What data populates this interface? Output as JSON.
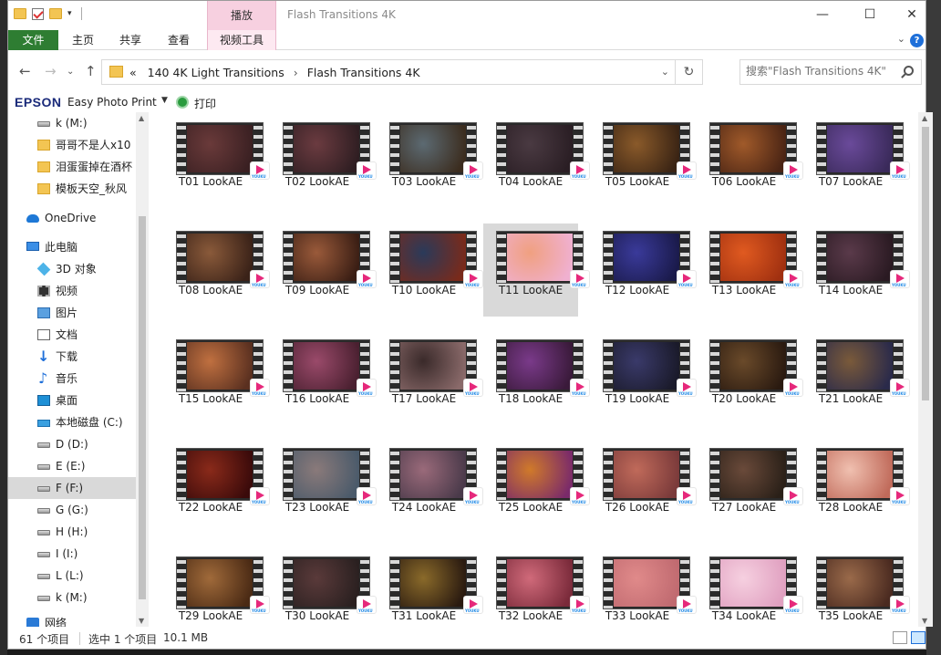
{
  "window_title": "Flash Transitions 4K",
  "context_tab_header": "播放",
  "ribbon_tabs": [
    {
      "label": "文件"
    },
    {
      "label": "主页"
    },
    {
      "label": "共享"
    },
    {
      "label": "查看"
    },
    {
      "label": "视频工具"
    }
  ],
  "address": {
    "overflow": "«",
    "segments": [
      "140 4K Light Transitions",
      "Flash Transitions 4K"
    ]
  },
  "search": {
    "placeholder": "搜索\"Flash Transitions 4K\""
  },
  "epson": {
    "logo": "EPSON",
    "app": "Easy Photo Print",
    "print_label": "打印"
  },
  "sidebar": [
    {
      "label": "k (M:)",
      "icon": "drive-icon"
    },
    {
      "label": "哥哥不是人x10",
      "icon": "folder-icon"
    },
    {
      "label": "泪蛋蛋掉在酒杯",
      "icon": "folder-icon"
    },
    {
      "label": "模板天空_秋风",
      "icon": "folder-icon"
    },
    {
      "label": "OneDrive",
      "icon": "cloud-icon"
    },
    {
      "label": "此电脑",
      "icon": "pc-icon"
    },
    {
      "label": "3D 对象",
      "icon": "3d-objects-icon"
    },
    {
      "label": "视频",
      "icon": "video-folder-icon"
    },
    {
      "label": "图片",
      "icon": "pictures-folder-icon"
    },
    {
      "label": "文档",
      "icon": "documents-folder-icon"
    },
    {
      "label": "下载",
      "icon": "downloads-folder-icon"
    },
    {
      "label": "音乐",
      "icon": "music-folder-icon"
    },
    {
      "label": "桌面",
      "icon": "desktop-folder-icon"
    },
    {
      "label": "本地磁盘 (C:)",
      "icon": "local-disk-icon"
    },
    {
      "label": "D (D:)",
      "icon": "drive-icon"
    },
    {
      "label": "E (E:)",
      "icon": "drive-icon"
    },
    {
      "label": "F (F:)",
      "icon": "drive-icon",
      "selected": true
    },
    {
      "label": "G (G:)",
      "icon": "drive-icon"
    },
    {
      "label": "H (H:)",
      "icon": "drive-icon"
    },
    {
      "label": "I (I:)",
      "icon": "drive-icon"
    },
    {
      "label": "L (L:)",
      "icon": "drive-icon"
    },
    {
      "label": "k (M:)",
      "icon": "drive-icon"
    },
    {
      "label": "网络",
      "icon": "network-icon"
    }
  ],
  "files": [
    {
      "name": "T01 LookAE",
      "c1": "#6a3a3a",
      "c2": "#3a2022"
    },
    {
      "name": "T02 LookAE",
      "c1": "#6b3b40",
      "c2": "#2f1e22"
    },
    {
      "name": "T03 LookAE",
      "c1": "#5c6a72",
      "c2": "#3b2c1e"
    },
    {
      "name": "T04 LookAE",
      "c1": "#4a3a42",
      "c2": "#2a1e24"
    },
    {
      "name": "T05 LookAE",
      "c1": "#8a5a2a",
      "c2": "#3a2414"
    },
    {
      "name": "T06 LookAE",
      "c1": "#a05a2a",
      "c2": "#4a2414"
    },
    {
      "name": "T07 LookAE",
      "c1": "#6a4a9a",
      "c2": "#3a2a5a"
    },
    {
      "name": "T08 LookAE",
      "c1": "#8a5a3a",
      "c2": "#3a2218"
    },
    {
      "name": "T09 LookAE",
      "c1": "#9a5a3a",
      "c2": "#3a1e14"
    },
    {
      "name": "T10 LookAE",
      "c1": "#2a3a5a",
      "c2": "#7a2a1a"
    },
    {
      "name": "T11 LookAE",
      "c1": "#f0a080",
      "c2": "#f0b0d0",
      "selected": true
    },
    {
      "name": "T12 LookAE",
      "c1": "#3a3a9a",
      "c2": "#1a1a4a"
    },
    {
      "name": "T13 LookAE",
      "c1": "#e05a20",
      "c2": "#a03010"
    },
    {
      "name": "T14 LookAE",
      "c1": "#5a3a4a",
      "c2": "#2a1a22"
    },
    {
      "name": "T15 LookAE",
      "c1": "#c07040",
      "c2": "#5a3020"
    },
    {
      "name": "T16 LookAE",
      "c1": "#9a4a6a",
      "c2": "#4a2030"
    },
    {
      "name": "T17 LookAE",
      "c1": "#3a2a2a",
      "c2": "#8a6a6a"
    },
    {
      "name": "T18 LookAE",
      "c1": "#7a3a8a",
      "c2": "#3a1a3a"
    },
    {
      "name": "T19 LookAE",
      "c1": "#3a3a6a",
      "c2": "#1a1a2a"
    },
    {
      "name": "T20 LookAE",
      "c1": "#6a4a2a",
      "c2": "#2a1a10"
    },
    {
      "name": "T21 LookAE",
      "c1": "#7a5a3a",
      "c2": "#2a2a4a"
    },
    {
      "name": "T22 LookAE",
      "c1": "#8a2a1a",
      "c2": "#3a0a0a"
    },
    {
      "name": "T23 LookAE",
      "c1": "#8a7a7a",
      "c2": "#4a5a6a"
    },
    {
      "name": "T24 LookAE",
      "c1": "#9a6a7a",
      "c2": "#4a3a4a"
    },
    {
      "name": "T25 LookAE",
      "c1": "#d07a2a",
      "c2": "#7a2a6a"
    },
    {
      "name": "T26 LookAE",
      "c1": "#c06a5a",
      "c2": "#7a3a3a"
    },
    {
      "name": "T27 LookAE",
      "c1": "#6a4a3a",
      "c2": "#2a2018"
    },
    {
      "name": "T28 LookAE",
      "c1": "#f0c0b0",
      "c2": "#c06a5a"
    },
    {
      "name": "T29 LookAE",
      "c1": "#a06a3a",
      "c2": "#4a2a14"
    },
    {
      "name": "T30 LookAE",
      "c1": "#5a3a3a",
      "c2": "#2a2020"
    },
    {
      "name": "T31 LookAE",
      "c1": "#8a6a2a",
      "c2": "#2a1a10"
    },
    {
      "name": "T32 LookAE",
      "c1": "#d06a7a",
      "c2": "#7a2a3a"
    },
    {
      "name": "T33 LookAE",
      "c1": "#e08a8a",
      "c2": "#c06a70"
    },
    {
      "name": "T34 LookAE",
      "c1": "#f6d0e0",
      "c2": "#e0a0c0"
    },
    {
      "name": "T35 LookAE",
      "c1": "#9a6a4a",
      "c2": "#4a2a20"
    }
  ],
  "status": {
    "count": "61 个项目",
    "selection": "选中 1 个项目",
    "size": "10.1 MB"
  },
  "colors": {
    "file_tab": "#2e7d32",
    "context_tab": "#f7d0e0",
    "badge_pink": "#e6287b"
  }
}
